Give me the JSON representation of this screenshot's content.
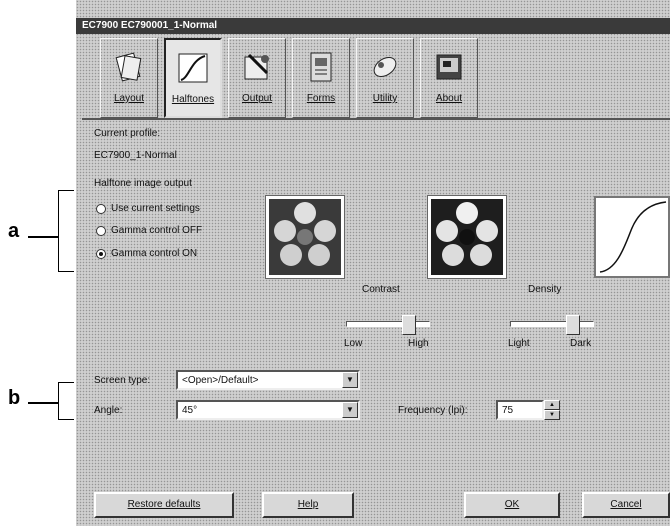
{
  "callouts": {
    "a": "a",
    "b": "b"
  },
  "window": {
    "title": "EC7900 EC790001_1-Normal"
  },
  "tabs": [
    {
      "label": "Layout",
      "icon": "layout-icon"
    },
    {
      "label": "Halftones",
      "icon": "halftone-curve-icon",
      "active": true
    },
    {
      "label": "Output",
      "icon": "output-icon"
    },
    {
      "label": "Forms",
      "icon": "forms-icon"
    },
    {
      "label": "Utility",
      "icon": "utility-icon"
    },
    {
      "label": "About",
      "icon": "about-icon"
    }
  ],
  "current_profile": {
    "label": "Current profile:",
    "value": "EC7900_1-Normal"
  },
  "halftone_output": {
    "group_label": "Halftone image output",
    "options": [
      {
        "label": "Use current settings",
        "selected": false
      },
      {
        "label": "Gamma control OFF",
        "selected": false
      },
      {
        "label": "Gamma control ON",
        "selected": true
      }
    ]
  },
  "contrast": {
    "label": "Contrast",
    "low": "Low",
    "high": "High",
    "level": 0.8
  },
  "density": {
    "label": "Density",
    "low": "Light",
    "high": "Dark",
    "level": 0.8
  },
  "screen_type": {
    "label": "Screen type:",
    "value": "<Open>/Default>"
  },
  "angle": {
    "label": "Angle:",
    "value": "45°"
  },
  "frequency": {
    "label": "Frequency (lpi):",
    "value": "75"
  },
  "buttons": {
    "restore": "Restore defaults",
    "help": "Help",
    "ok": "OK",
    "cancel": "Cancel"
  }
}
